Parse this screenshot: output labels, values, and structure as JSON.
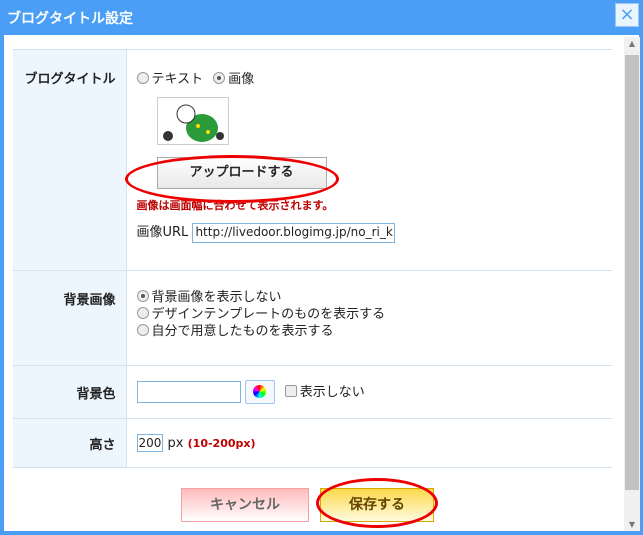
{
  "dialog": {
    "title": "ブログタイトル設定",
    "close": "×"
  },
  "rows": {
    "title": {
      "label": "ブログタイトル",
      "opt_text": "テキスト",
      "opt_image": "画像",
      "upload": "アップロードする",
      "note": "画像は画面幅に合わせて表示されます。",
      "url_label": "画像URL",
      "url_value": "http://livedoor.blogimg.jp/no_ri_ki/im"
    },
    "bgimage": {
      "label": "背景画像",
      "opts": [
        "背景画像を表示しない",
        "デザインテンプレートのものを表示する",
        "自分で用意したものを表示する"
      ]
    },
    "bgcolor": {
      "label": "背景色",
      "value": "",
      "hide": "表示しない"
    },
    "height": {
      "label": "高さ",
      "value": "200",
      "unit": "px",
      "range": "(10-200px)"
    }
  },
  "buttons": {
    "cancel": "キャンセル",
    "save": "保存する"
  }
}
